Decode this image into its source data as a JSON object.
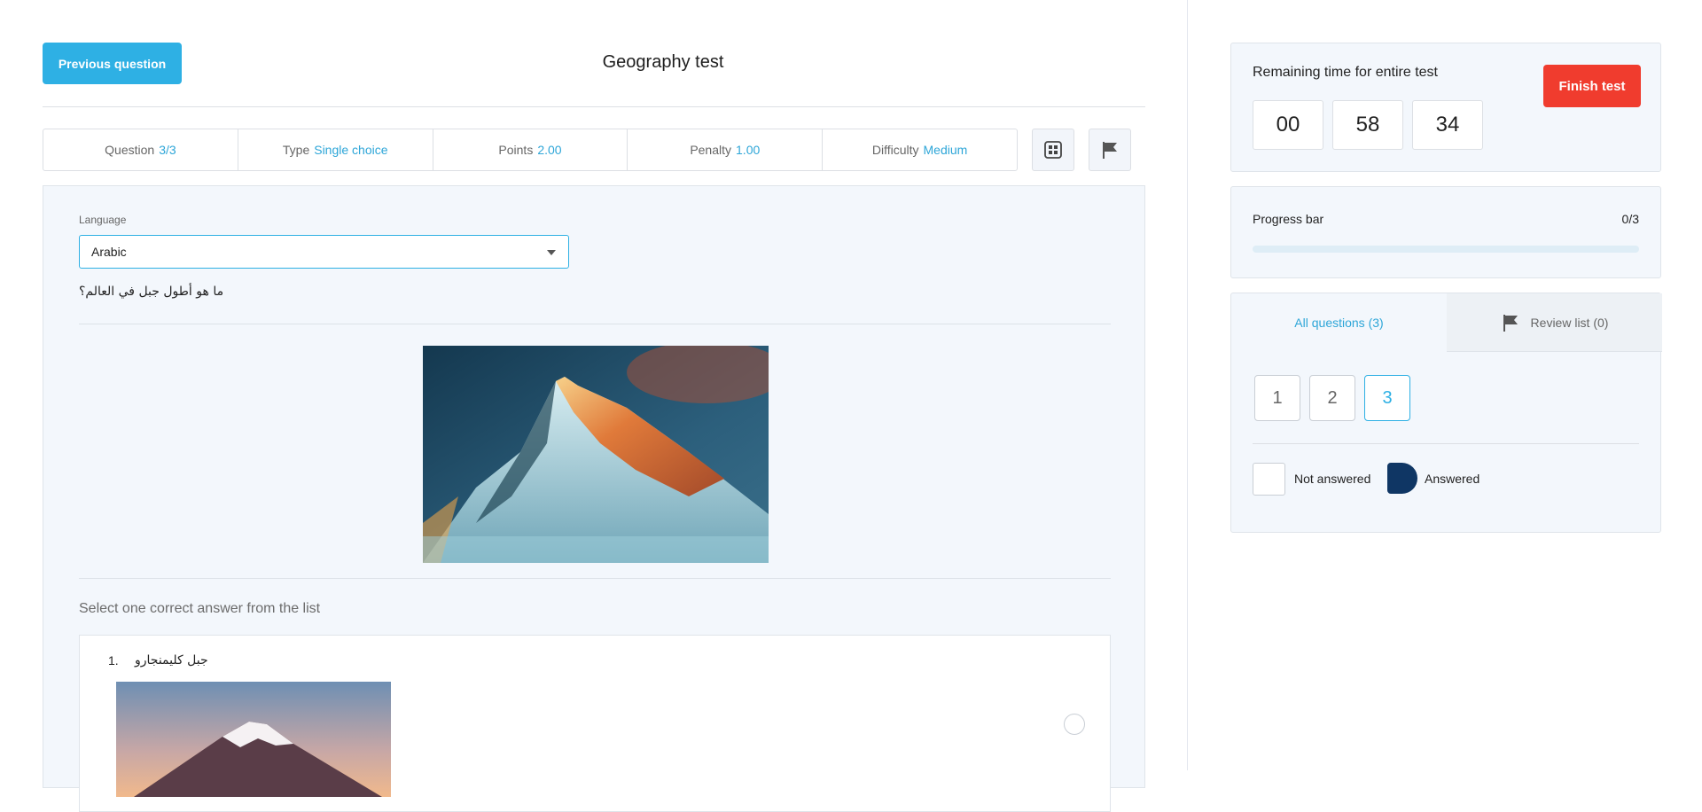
{
  "header": {
    "prev_button": "Previous question",
    "title": "Geography test"
  },
  "info": [
    {
      "label": "Question",
      "value": "3/3"
    },
    {
      "label": "Type",
      "value": "Single choice"
    },
    {
      "label": "Points",
      "value": "2.00"
    },
    {
      "label": "Penalty",
      "value": "1.00"
    },
    {
      "label": "Difficulty",
      "value": "Medium"
    }
  ],
  "toolbar": {
    "grid_icon": "grid-icon",
    "flag_icon": "flag-icon"
  },
  "question": {
    "language_label": "Language",
    "language_value": "Arabic",
    "text": "ما هو أطول جبل في العالم؟",
    "instruction": "Select one correct answer from the list",
    "answers": [
      {
        "number": "1.",
        "text": "جبل كليمنجارو"
      }
    ]
  },
  "timer": {
    "label": "Remaining time for entire test",
    "hours": "00",
    "minutes": "58",
    "seconds": "34",
    "finish_button": "Finish test"
  },
  "progress": {
    "label": "Progress bar",
    "count": "0/3",
    "fraction": 0
  },
  "navigator": {
    "tab_all": "All questions (3)",
    "tab_review": "Review list (0)",
    "questions": [
      "1",
      "2",
      "3"
    ],
    "current": "3",
    "legend_not_answered": "Not answered",
    "legend_answered": "Answered"
  },
  "colors": {
    "accent": "#2eb0e4",
    "danger": "#f03c2e",
    "answered": "#0f3664",
    "panel": "#f3f7fc"
  }
}
